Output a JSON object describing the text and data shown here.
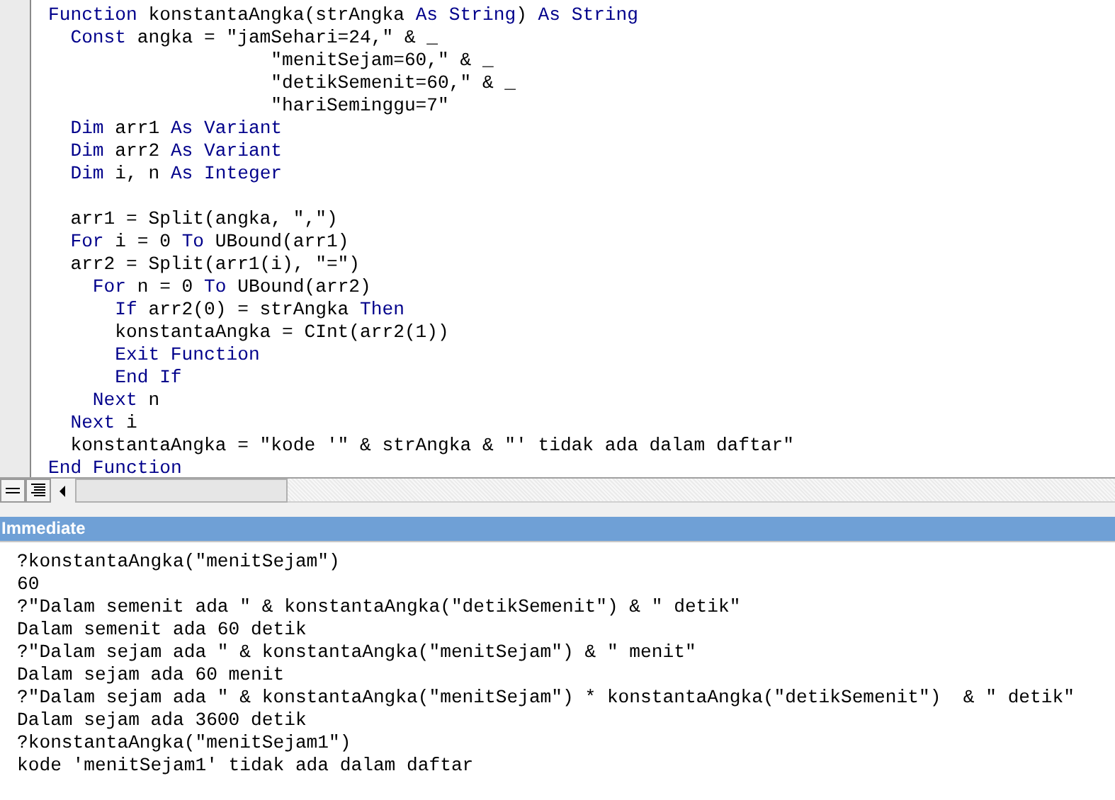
{
  "code_lines": [
    {
      "kind": "code",
      "tokens": [
        {
          "kind": "keyword",
          "text": "Function"
        },
        {
          "kind": "plain",
          "text": " konstantaAngka(strAngka "
        },
        {
          "kind": "keyword",
          "text": "As"
        },
        {
          "kind": "keyword",
          "text": " String"
        },
        {
          "kind": "plain",
          "text": ") "
        },
        {
          "kind": "keyword",
          "text": "As"
        },
        {
          "kind": "keyword",
          "text": " String"
        }
      ]
    },
    {
      "kind": "code",
      "tokens": [
        {
          "kind": "keyword",
          "text": "  Const"
        },
        {
          "kind": "plain",
          "text": " angka = \"jamSehari=24,\" & _"
        }
      ]
    },
    {
      "kind": "code",
      "tokens": [
        {
          "kind": "plain",
          "text": "                    \"menitSejam=60,\" & _"
        }
      ]
    },
    {
      "kind": "code",
      "tokens": [
        {
          "kind": "plain",
          "text": "                    \"detikSemenit=60,\" & _"
        }
      ]
    },
    {
      "kind": "code",
      "tokens": [
        {
          "kind": "plain",
          "text": "                    \"hariSeminggu=7\""
        }
      ]
    },
    {
      "kind": "code",
      "tokens": [
        {
          "kind": "keyword",
          "text": "  Dim"
        },
        {
          "kind": "plain",
          "text": " arr1 "
        },
        {
          "kind": "keyword",
          "text": "As"
        },
        {
          "kind": "keyword",
          "text": " Variant"
        }
      ]
    },
    {
      "kind": "code",
      "tokens": [
        {
          "kind": "keyword",
          "text": "  Dim"
        },
        {
          "kind": "plain",
          "text": " arr2 "
        },
        {
          "kind": "keyword",
          "text": "As"
        },
        {
          "kind": "keyword",
          "text": " Variant"
        }
      ]
    },
    {
      "kind": "code",
      "tokens": [
        {
          "kind": "keyword",
          "text": "  Dim"
        },
        {
          "kind": "plain",
          "text": " i, n "
        },
        {
          "kind": "keyword",
          "text": "As"
        },
        {
          "kind": "keyword",
          "text": " Integer"
        }
      ]
    },
    {
      "kind": "blank"
    },
    {
      "kind": "code",
      "tokens": [
        {
          "kind": "plain",
          "text": "  arr1 = Split(angka, \",\")"
        }
      ]
    },
    {
      "kind": "code",
      "tokens": [
        {
          "kind": "keyword",
          "text": "  For"
        },
        {
          "kind": "plain",
          "text": " i = 0 "
        },
        {
          "kind": "keyword",
          "text": "To"
        },
        {
          "kind": "plain",
          "text": " UBound(arr1)"
        }
      ]
    },
    {
      "kind": "code",
      "tokens": [
        {
          "kind": "plain",
          "text": "  arr2 = Split(arr1(i), \"=\")"
        }
      ]
    },
    {
      "kind": "code",
      "tokens": [
        {
          "kind": "keyword",
          "text": "    For"
        },
        {
          "kind": "plain",
          "text": " n = 0 "
        },
        {
          "kind": "keyword",
          "text": "To"
        },
        {
          "kind": "plain",
          "text": " UBound(arr2)"
        }
      ]
    },
    {
      "kind": "code",
      "tokens": [
        {
          "kind": "keyword",
          "text": "      If"
        },
        {
          "kind": "plain",
          "text": " arr2(0) = strAngka "
        },
        {
          "kind": "keyword",
          "text": "Then"
        }
      ]
    },
    {
      "kind": "code",
      "tokens": [
        {
          "kind": "plain",
          "text": "      konstantaAngka = CInt(arr2(1))"
        }
      ]
    },
    {
      "kind": "code",
      "tokens": [
        {
          "kind": "keyword",
          "text": "      Exit"
        },
        {
          "kind": "keyword",
          "text": " Function"
        }
      ]
    },
    {
      "kind": "code",
      "tokens": [
        {
          "kind": "keyword",
          "text": "      End"
        },
        {
          "kind": "keyword",
          "text": " If"
        }
      ]
    },
    {
      "kind": "code",
      "tokens": [
        {
          "kind": "keyword",
          "text": "    Next"
        },
        {
          "kind": "plain",
          "text": " n"
        }
      ]
    },
    {
      "kind": "code",
      "tokens": [
        {
          "kind": "keyword",
          "text": "  Next"
        },
        {
          "kind": "plain",
          "text": " i"
        }
      ]
    },
    {
      "kind": "code",
      "tokens": [
        {
          "kind": "plain",
          "text": "  konstantaAngka = \"kode '\" & strAngka & \"' tidak ada dalam daftar\""
        }
      ]
    },
    {
      "kind": "code",
      "tokens": [
        {
          "kind": "keyword",
          "text": "End"
        },
        {
          "kind": "keyword",
          "text": " Function"
        }
      ]
    }
  ],
  "immediate": {
    "title": "Immediate",
    "lines": [
      "?konstantaAngka(\"menitSejam\")",
      "60",
      "?\"Dalam semenit ada \" & konstantaAngka(\"detikSemenit\") & \" detik\"",
      "Dalam semenit ada 60 detik",
      "?\"Dalam sejam ada \" & konstantaAngka(\"menitSejam\") & \" menit\"",
      "Dalam sejam ada 60 menit",
      "?\"Dalam sejam ada \" & konstantaAngka(\"menitSejam\") * konstantaAngka(\"detikSemenit\")  & \" detik\"",
      "Dalam sejam ada 3600 detik",
      "?konstantaAngka(\"menitSejam1\")",
      "kode 'menitSejam1' tidak ada dalam daftar"
    ]
  }
}
